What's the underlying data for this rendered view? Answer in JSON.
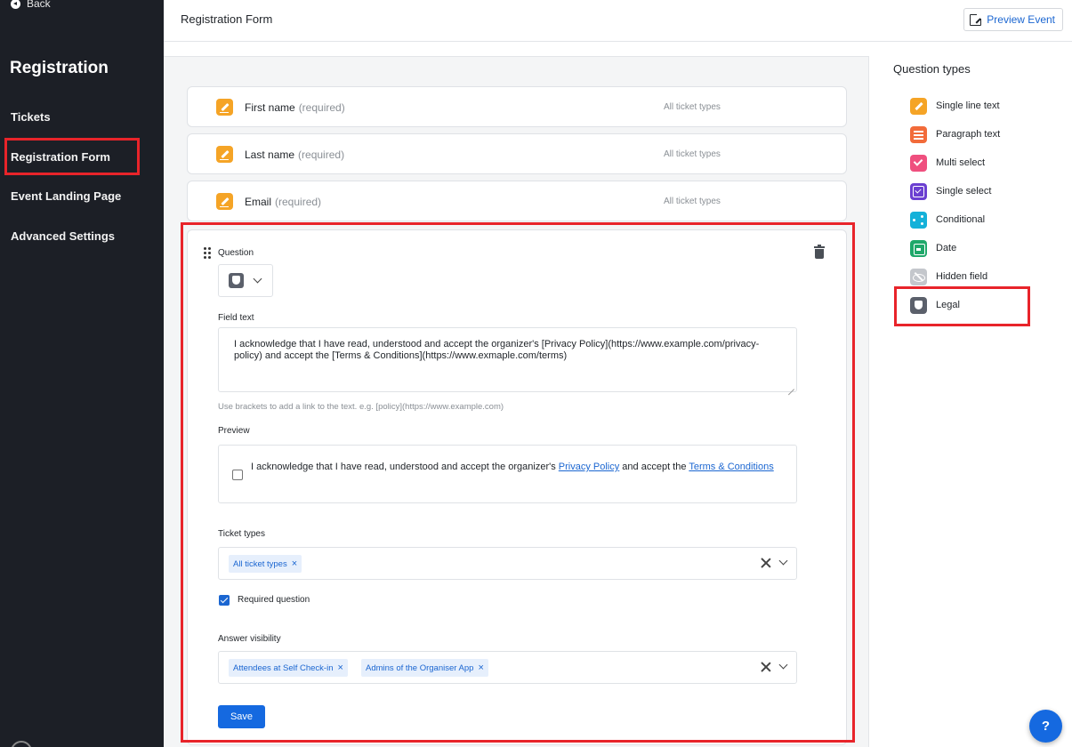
{
  "sidebar": {
    "back_label": "Back",
    "title": "Registration",
    "items": [
      {
        "label": "Tickets"
      },
      {
        "label": "Registration Form"
      },
      {
        "label": "Event Landing Page"
      },
      {
        "label": "Advanced Settings"
      }
    ]
  },
  "header": {
    "title": "Registration Form",
    "preview_button": "Preview Event"
  },
  "fields": [
    {
      "label": "First name",
      "required": "(required)",
      "ticket_types": "All ticket types"
    },
    {
      "label": "Last name",
      "required": "(required)",
      "ticket_types": "All ticket types"
    },
    {
      "label": "Email",
      "required": "(required)",
      "ticket_types": "All ticket types"
    }
  ],
  "editor": {
    "question_label": "Question",
    "field_text_label": "Field text",
    "field_text_value": "I acknowledge that I have read, understood and accept the organizer's [Privacy Policy](https://www.example.com/privacy-policy) and accept the [Terms & Conditions](https://www.exmaple.com/terms)",
    "hint": "Use brackets to add a link to the text. e.g. [policy](https://www.example.com)",
    "preview_label": "Preview",
    "preview_text_before": "I acknowledge that I have read, understood and accept the organizer's ",
    "preview_link1": "Privacy Policy",
    "preview_text_middle": " and accept the ",
    "preview_link2": "Terms & Conditions",
    "ticket_types_label": "Ticket types",
    "ticket_types_chips": [
      "All ticket types"
    ],
    "required_label": "Required question",
    "required_checked": true,
    "visibility_label": "Answer visibility",
    "visibility_chips": [
      "Attendees at Self Check-in",
      "Admins of the Organiser App"
    ],
    "save_label": "Save"
  },
  "question_types": {
    "title": "Question types",
    "items": [
      {
        "label": "Single line text",
        "icon": "pencil-icon",
        "color": "#f5a426"
      },
      {
        "label": "Paragraph text",
        "icon": "paragraph-icon",
        "color": "#f26b3a"
      },
      {
        "label": "Multi select",
        "icon": "multi-check-icon",
        "color": "#ef4f7e"
      },
      {
        "label": "Single select",
        "icon": "checkbox-icon",
        "color": "#6b3fd1"
      },
      {
        "label": "Conditional",
        "icon": "branch-icon",
        "color": "#14b1d9"
      },
      {
        "label": "Date",
        "icon": "calendar-icon",
        "color": "#1fa86a"
      },
      {
        "label": "Hidden field",
        "icon": "eye-off-icon",
        "color": "#c4c7cc"
      },
      {
        "label": "Legal",
        "icon": "shield-icon",
        "color": "#5b606b"
      }
    ]
  },
  "help_label": "?"
}
